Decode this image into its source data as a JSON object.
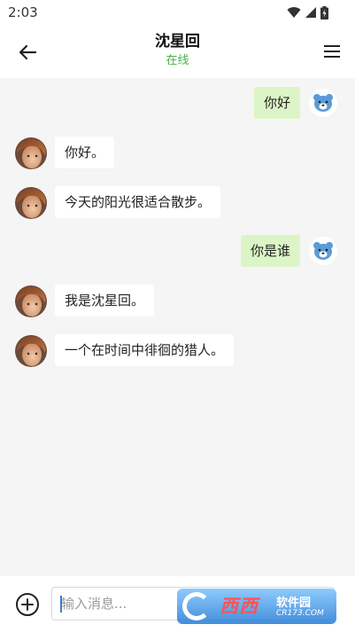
{
  "status_bar": {
    "time": "2:03"
  },
  "header": {
    "title": "沈星回",
    "status": "在线"
  },
  "messages": [
    {
      "side": "right",
      "text": "你好"
    },
    {
      "side": "left",
      "text": "你好。"
    },
    {
      "side": "left",
      "text": "今天的阳光很适合散步。"
    },
    {
      "side": "right",
      "text": "你是谁"
    },
    {
      "side": "left",
      "text": "我是沈星回。"
    },
    {
      "side": "left",
      "text": "一个在时间中徘徊的猎人。"
    }
  ],
  "composer": {
    "placeholder": "输入消息..."
  },
  "watermark": {
    "brand": "西西",
    "title": "软件园",
    "site": "CR173.COM"
  },
  "colors": {
    "online": "#4caf50",
    "outgoing_bubble": "#dcf5c6",
    "incoming_bubble": "#ffffff"
  }
}
